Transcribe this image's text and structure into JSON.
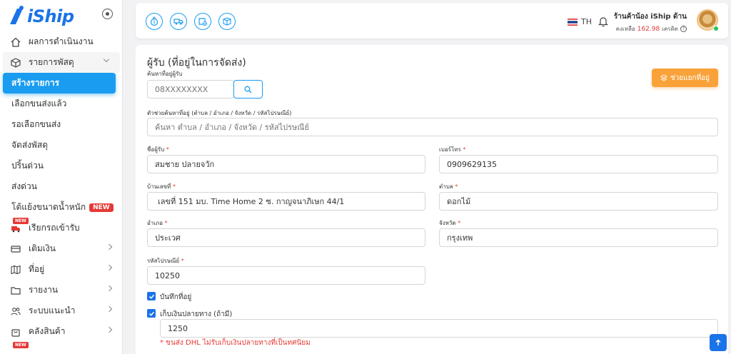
{
  "brand": {
    "logo_text": "iShip"
  },
  "sidebar": {
    "items": [
      {
        "label": "ผลการดำเนินงาน"
      },
      {
        "label": "รายการพัสดุ"
      },
      {
        "label": "สร้างรายการ"
      },
      {
        "label": "เลือกขนส่งแล้ว"
      },
      {
        "label": "รอเลือกขนส่ง"
      },
      {
        "label": "จัดส่งพัสดุ"
      },
      {
        "label": "ปริ้นด่วน"
      },
      {
        "label": "ส่งด่วน"
      },
      {
        "label": "โต้แย้งขนาดน้ำหนัก",
        "badge": "NEW"
      },
      {
        "label": "เรียกรถเข้ารับ",
        "badge": "NEW"
      },
      {
        "label": "เติมเงิน"
      },
      {
        "label": "ที่อยู่"
      },
      {
        "label": "รายงาน"
      },
      {
        "label": "ระบบแนะนำ"
      },
      {
        "label": "คลังสินค้า"
      },
      {
        "badge": "NEW"
      }
    ]
  },
  "header": {
    "lang": "TH",
    "shop_name": "ร้านค้าน้อง iShip ด้าน",
    "credit_prefix": "คงเหลือ",
    "credit_amount": "162.98",
    "credit_suffix": "เครดิต"
  },
  "form": {
    "title": "ผู้รับ (ที่อยู่ในการจัดส่ง)",
    "search_receiver_label": "ค้นหาที่อยู่ผู้รับ",
    "search_receiver_placeholder": "08XXXXXXXX",
    "split_address_label": "ช่วยแยกที่อยู่",
    "address_helper_label": "ตัวช่วยค้นหาที่อยู่ (ตำบล / อำเภอ / จังหวัด / รหัสไปรษณีย์)",
    "address_helper_placeholder": "ค้นหา ตำบล / อำเภอ / จังหวัด / รหัสไปรษณีย์",
    "name_label": "ชื่อผู้รับ",
    "name_value": "สมชาย ปลายจวัก",
    "phone_label": "เบอร์โทร",
    "phone_value": "0909629135",
    "house_label": "บ้านเลขที่",
    "house_value": "เลขที่ 151 มบ. Time Home 2 ซ. กาญจนาภิเษก 44/1",
    "subdistrict_label": "ตำบล",
    "subdistrict_value": "ดอกไม้",
    "district_label": "อำเภอ",
    "district_value": "ประเวศ",
    "province_label": "จังหวัด",
    "province_value": "กรุงเทพ",
    "postcode_label": "รหัสไปรษณีย์",
    "postcode_value": "10250",
    "save_address_label": "บันทึกที่อยู่",
    "cod_label": "เก็บเงินปลายทาง (ถ้ามี)",
    "cod_value": "1250",
    "warning": "* ขนส่ง DHL ไม่รับเก็บเงินปลายทางที่เป็นทศนิยม",
    "required_mark": "*"
  },
  "colors": {
    "accent": "#1a9cf0",
    "orange": "#f9a23a",
    "danger": "#e53935"
  }
}
